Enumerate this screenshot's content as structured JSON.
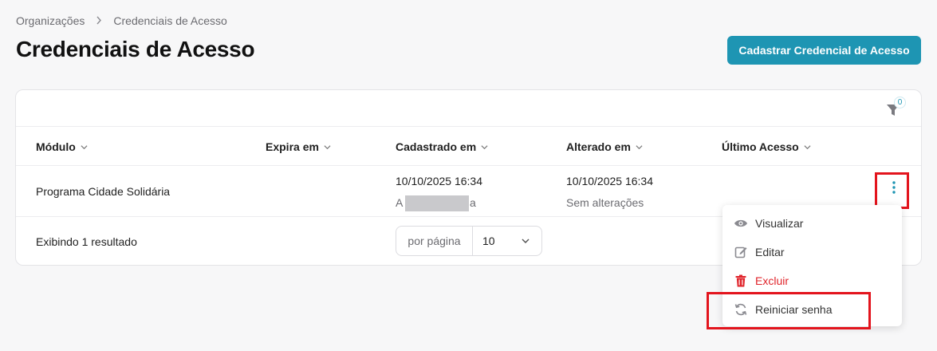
{
  "breadcrumb": {
    "items": [
      "Organizações",
      "Credenciais de Acesso"
    ]
  },
  "header": {
    "title": "Credenciais de Acesso",
    "primary_action": "Cadastrar Credencial de Acesso"
  },
  "filter": {
    "icon": "filter-icon",
    "count": "0"
  },
  "table": {
    "columns": [
      "Módulo",
      "Expira em",
      "Cadastrado em",
      "Alterado em",
      "Último Acesso"
    ],
    "rows": [
      {
        "modulo": "Programa Cidade Solidária",
        "expira_em": "",
        "cadastrado_em": "10/10/2025 16:34",
        "cadastrado_por_start": "A",
        "cadastrado_por_end": "a",
        "alterado_em": "10/10/2025 16:34",
        "alterado_sub": "Sem alterações",
        "ultimo_acesso": ""
      }
    ]
  },
  "footer": {
    "result_text": "Exibindo 1 resultado",
    "per_page_label": "por página",
    "per_page_value": "10"
  },
  "row_menu": {
    "items": [
      {
        "label": "Visualizar",
        "icon": "eye-icon"
      },
      {
        "label": "Editar",
        "icon": "edit-icon"
      },
      {
        "label": "Excluir",
        "icon": "trash-icon"
      },
      {
        "label": "Reiniciar senha",
        "icon": "refresh-icon"
      }
    ]
  },
  "colors": {
    "accent": "#1e95b3",
    "danger": "#e0242b",
    "highlight": "#e3141d"
  }
}
